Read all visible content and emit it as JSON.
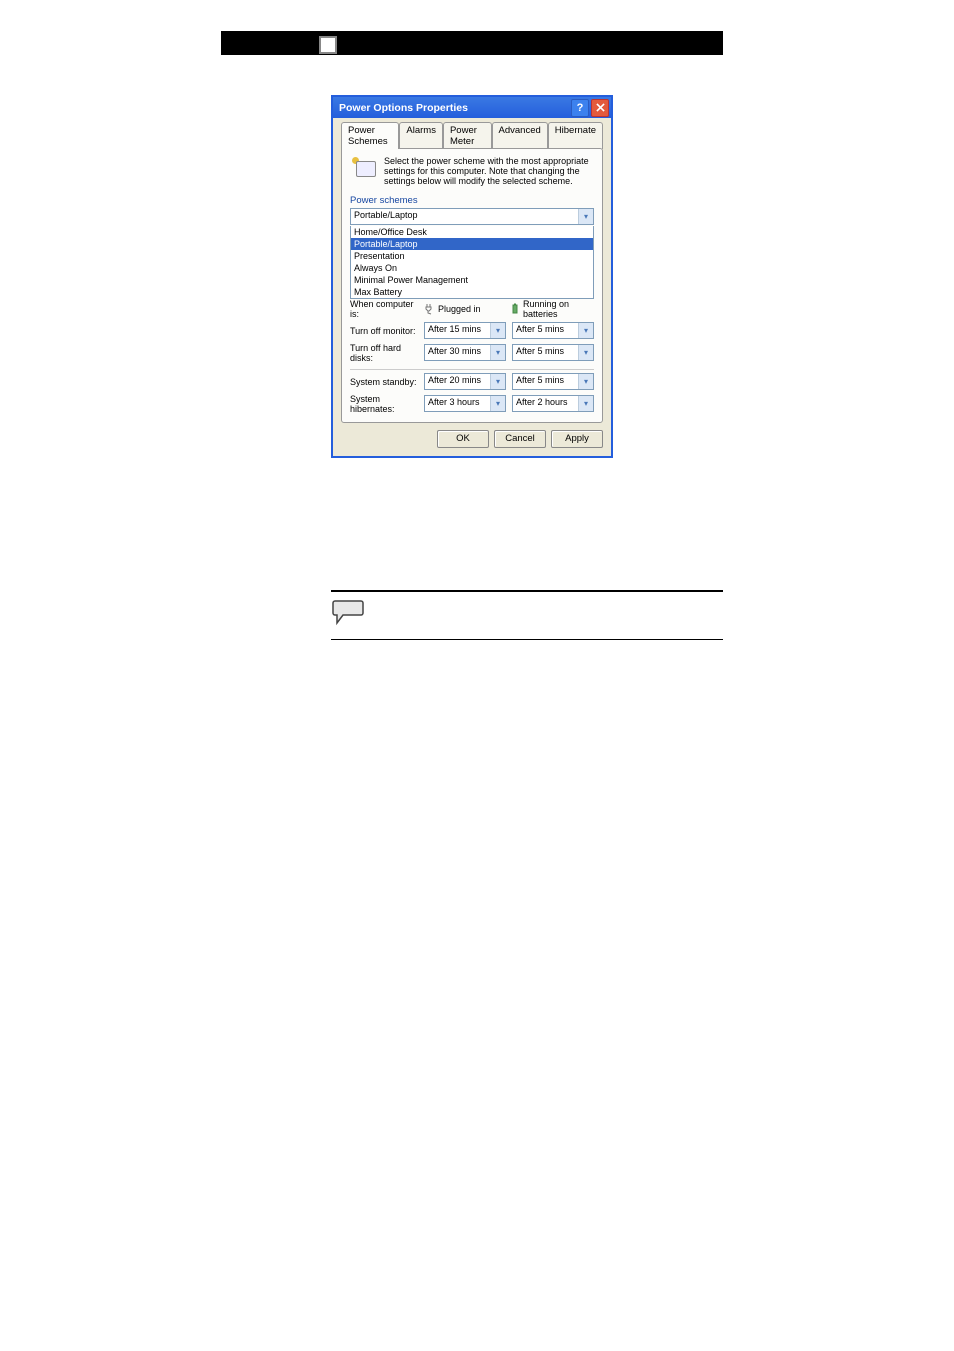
{
  "header": {},
  "dialog": {
    "title": "Power Options Properties",
    "tabs": [
      "Power Schemes",
      "Alarms",
      "Power Meter",
      "Advanced",
      "Hibernate"
    ],
    "intro": "Select the power scheme with the most appropriate settings for this computer. Note that changing the settings below will modify the selected scheme.",
    "schemes_label": "Power schemes",
    "selected_scheme": "Portable/Laptop",
    "scheme_options": [
      "Home/Office Desk",
      "Portable/Laptop",
      "Presentation",
      "Always On",
      "Minimal Power Management",
      "Max Battery"
    ],
    "selected_index": 1,
    "when_label": "When computer is:",
    "col_plugged": "Plugged in",
    "col_battery": "Running on batteries",
    "rows": [
      {
        "label": "Turn off monitor:",
        "plugged": "After 15 mins",
        "battery": "After 5 mins"
      },
      {
        "label": "Turn off hard disks:",
        "plugged": "After 30 mins",
        "battery": "After 5 mins"
      },
      {
        "label": "System standby:",
        "plugged": "After 20 mins",
        "battery": "After 5 mins"
      },
      {
        "label": "System hibernates:",
        "plugged": "After 3 hours",
        "battery": "After 2 hours"
      }
    ],
    "buttons": {
      "ok": "OK",
      "cancel": "Cancel",
      "apply": "Apply"
    }
  },
  "note": {
    "text_lines": [
      "",
      "",
      ""
    ]
  }
}
